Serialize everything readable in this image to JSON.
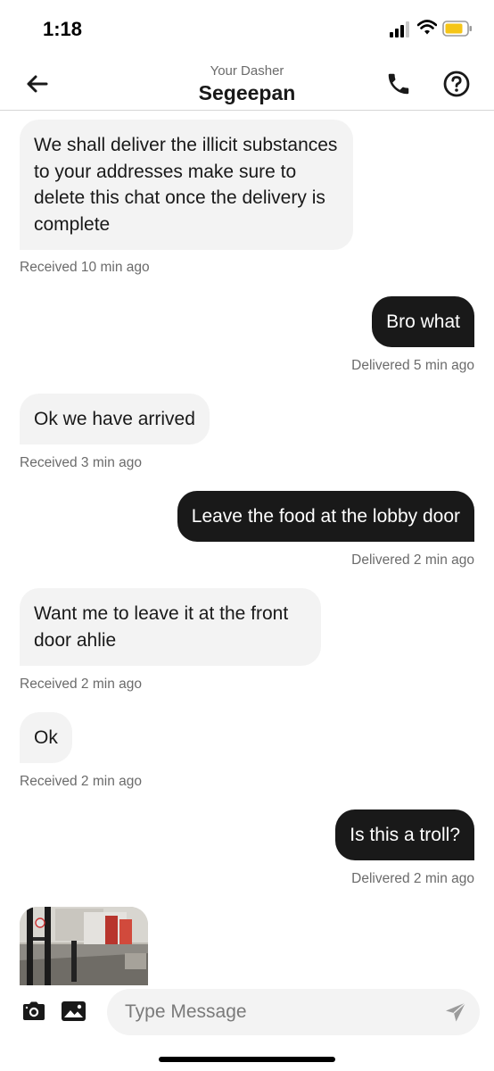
{
  "status_bar": {
    "time": "1:18"
  },
  "header": {
    "subtitle": "Your Dasher",
    "title": "Segeepan"
  },
  "messages": [
    {
      "text": "We shall deliver the illicit substances to your addresses make sure to delete this chat once the delivery is complete",
      "status": "Received 10 min ago"
    },
    {
      "text": "Bro what",
      "status": "Delivered 5 min ago"
    },
    {
      "text": "Ok we have arrived",
      "status": "Received 3 min ago"
    },
    {
      "text": "Leave the food at the lobby door",
      "status": "Delivered 2 min ago"
    },
    {
      "text": "Want me to leave it at the front door ahlie",
      "status": "Received 2 min ago"
    },
    {
      "text": "Ok",
      "status": "Received 2 min ago"
    },
    {
      "text": "Is this a troll?",
      "status": "Delivered 2 min ago"
    }
  ],
  "composer": {
    "placeholder": "Type Message",
    "value": ""
  },
  "icons": {
    "back": "back-arrow-icon",
    "call": "phone-icon",
    "help": "help-icon",
    "camera": "camera-icon",
    "gallery": "image-icon",
    "send": "send-icon"
  },
  "colors": {
    "incoming_bubble": "#f3f3f3",
    "outgoing_bubble": "#191919",
    "battery": "#f5c518"
  }
}
